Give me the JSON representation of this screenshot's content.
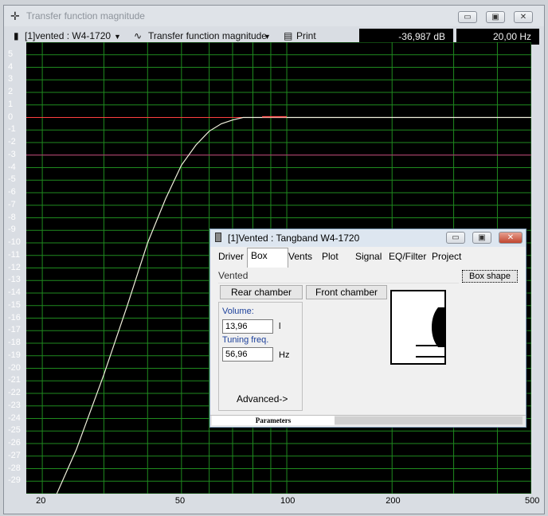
{
  "window": {
    "title": "Transfer function magnitude",
    "minimize_glyph": "▭",
    "maximize_glyph": "▣",
    "close_glyph": "✕"
  },
  "toolbar": {
    "driver_select": "[1]vented : W4-1720",
    "plot_select": "Transfer function magnitude",
    "print_label": "Print",
    "readout_db": "-36,987 dB",
    "readout_hz": "20,00 Hz"
  },
  "chart_data": {
    "type": "line",
    "xscale": "log",
    "xlim": [
      18,
      500
    ],
    "ylim": [
      -30,
      6
    ],
    "y_ticks": [
      "5",
      "4",
      "3",
      "2",
      "1",
      "0",
      "-1",
      "-2",
      "-3",
      "-4",
      "-5",
      "-6",
      "-7",
      "-8",
      "-9",
      "-10",
      "-11",
      "-12",
      "-13",
      "-14",
      "-15",
      "-16",
      "-17",
      "-18",
      "-19",
      "-20",
      "-21",
      "-22",
      "-23",
      "-24",
      "-25",
      "-26",
      "-27",
      "-28",
      "-29"
    ],
    "x_ticks": [
      "20",
      "50",
      "100",
      "200",
      "500"
    ],
    "grid": true,
    "reference_lines": [
      {
        "y": 0,
        "color": "#ff4040"
      },
      {
        "y": -3,
        "color": "#c0307a"
      }
    ],
    "series": [
      {
        "color": "#f0f0dc",
        "x": [
          22,
          25,
          30,
          35,
          40,
          45,
          50,
          55,
          60,
          65,
          70,
          75,
          80,
          90,
          100,
          150,
          200,
          300,
          500
        ],
        "y": [
          -30,
          -26.5,
          -20.5,
          -15,
          -10,
          -6.5,
          -3.8,
          -2.2,
          -1.1,
          -0.5,
          -0.2,
          0,
          0,
          0,
          0,
          0,
          0,
          0,
          0
        ]
      },
      {
        "color": "#ff5050",
        "x": [
          85,
          100
        ],
        "y": [
          0.05,
          0.05
        ]
      }
    ]
  },
  "panel": {
    "title": "[1]Vented : Tangband W4-1720",
    "tabs": [
      "Driver",
      "Box",
      "Vents",
      "Plot",
      "Signal",
      "EQ/Filter",
      "Project"
    ],
    "active_tab": "Box",
    "box_type": "Vented",
    "box_shape_button": "Box shape",
    "rear_chamber_button": "Rear chamber",
    "front_chamber_button": "Front chamber",
    "volume_label": "Volume:",
    "volume_value": "13,96",
    "volume_unit": "l",
    "tuning_label": "Tuning freq.",
    "tuning_value": "56,96",
    "tuning_unit": "Hz",
    "advanced_button": "Advanced->",
    "status_tab": "Parameters"
  }
}
